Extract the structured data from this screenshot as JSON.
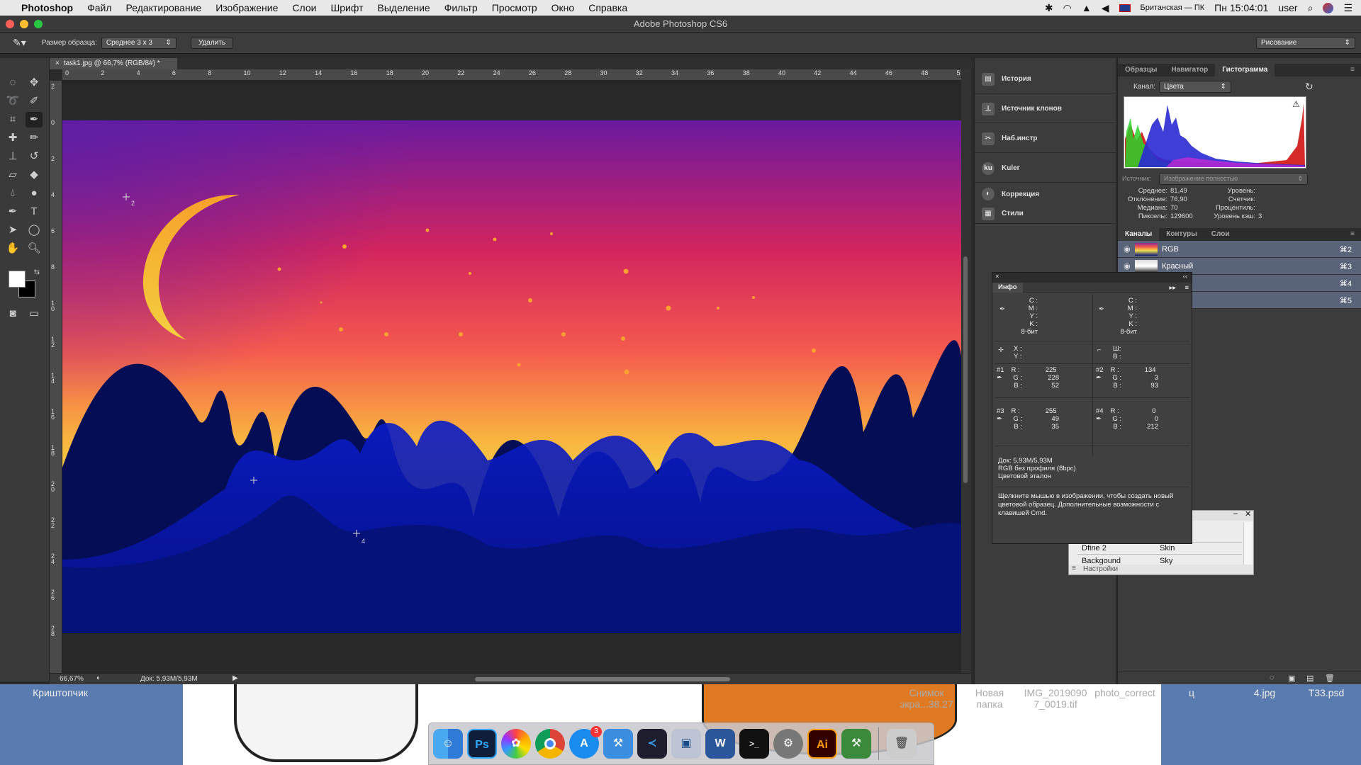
{
  "menubar": {
    "app_name": "Photoshop",
    "items": [
      "Файл",
      "Редактирование",
      "Изображение",
      "Слои",
      "Шрифт",
      "Выделение",
      "Фильтр",
      "Просмотр",
      "Окно",
      "Справка"
    ],
    "input_source": "Британская — ПК",
    "clock": "Пн 15:04:01",
    "user": "user"
  },
  "window": {
    "title": "Adobe Photoshop CS6"
  },
  "options": {
    "sample_size_label": "Размер образца:",
    "sample_size_value": "Среднее 3 х 3",
    "delete_button": "Удалить",
    "workspace": "Рисование"
  },
  "document": {
    "tab_title": "task1.jpg @ 66,7% (RGB/8#) *",
    "zoom": "66,67%",
    "doc_size": "Док: 5,93M/5,93M",
    "ruler_top": [
      "0",
      "2",
      "4",
      "6",
      "8",
      "10",
      "12",
      "14",
      "16",
      "18",
      "20",
      "22",
      "24",
      "26",
      "28",
      "30",
      "32",
      "34",
      "36",
      "38",
      "40",
      "42",
      "44",
      "46",
      "48",
      "5"
    ],
    "ruler_left": [
      "2",
      "0",
      "2",
      "4",
      "6",
      "8",
      "1 0",
      "1 2",
      "1 4",
      "1 6",
      "1 8",
      "2 0",
      "2 2",
      "2 4",
      "2 6",
      "2 8"
    ],
    "samplers": [
      "2",
      "4"
    ]
  },
  "dock_panels": [
    "История",
    "Источник клонов",
    "Наб.инстр",
    "Kuler",
    "Коррекция",
    "Стили"
  ],
  "histogram_panel": {
    "tabs": [
      "Образцы",
      "Навигатор",
      "Гистограмма"
    ],
    "channel_label": "Канал:",
    "channel_value": "Цвета",
    "source_label": "Источник:",
    "source_value": "Изображение полностью",
    "stats": {
      "mean_label": "Среднее:",
      "mean": "81,49",
      "deviation_label": "Отклонение:",
      "deviation": "76,90",
      "median_label": "Медиана:",
      "median": "70",
      "pixels_label": "Пикселы:",
      "pixels": "129600",
      "level_label": "Уровень:",
      "count_label": "Счетчик:",
      "percentile_label": "Процентиль:",
      "cache_label": "Уровень кэш:",
      "cache": "3"
    }
  },
  "channels_panel": {
    "tabs": [
      "Каналы",
      "Контуры",
      "Слои"
    ],
    "rows": [
      {
        "name": "RGB",
        "shortcut": "⌘2"
      },
      {
        "name": "Красный",
        "shortcut": "⌘3"
      },
      {
        "name": "",
        "shortcut": "⌘4"
      },
      {
        "name": "",
        "shortcut": "⌘5"
      }
    ]
  },
  "info_panel": {
    "title": "Инфо",
    "cmyk_labels": [
      "C :",
      "M :",
      "Y :",
      "K :"
    ],
    "bit_depth": "8-бит",
    "xy_labels": [
      "X :",
      "Y :"
    ],
    "wh_labels": [
      "Ш:",
      "В :"
    ],
    "samplers": [
      {
        "id": "#1",
        "r": "225",
        "g": "228",
        "b": "52"
      },
      {
        "id": "#2",
        "r": "134",
        "g": "3",
        "b": "93"
      },
      {
        "id": "#3",
        "r": "255",
        "g": "49",
        "b": "35"
      },
      {
        "id": "#4",
        "r": "0",
        "g": "0",
        "b": "212"
      }
    ],
    "doc_line": "Док: 5,93M/5,93M",
    "profile_line": "RGB без профиля (8bpc)",
    "proof_line": "Цветовой эталон",
    "hint": "Щелкните мышью в изображении, чтобы создать новый цветовой образец. Дополнительные возможности с клавишей Cmd."
  },
  "table_window": {
    "rows": [
      [
        "Dfine 2",
        "Skin"
      ],
      [
        "Backgound",
        "Sky"
      ]
    ],
    "footer": "Настройки"
  },
  "desktop": {
    "left_label": "Криштопчик",
    "labels": [
      "Снимок экра...38.27",
      "Новая папка",
      "IMG_20190907_0019.tif",
      "photo_correct",
      "ц",
      "4.jpg",
      "T33.psd"
    ]
  },
  "dock": {
    "apps": [
      "finder-icon",
      "photoshop-icon",
      "photos-icon",
      "chrome-icon",
      "appstore-icon",
      "xcode-icon",
      "vscode-icon",
      "virtualbox-icon",
      "word-icon",
      "terminal-icon",
      "preferences-icon",
      "illustrator-icon",
      "android-studio-icon",
      "trash-icon"
    ],
    "badge": "3"
  },
  "colors": {
    "accent": "#4a90d9",
    "ps_bg": "#2b2b2b"
  }
}
